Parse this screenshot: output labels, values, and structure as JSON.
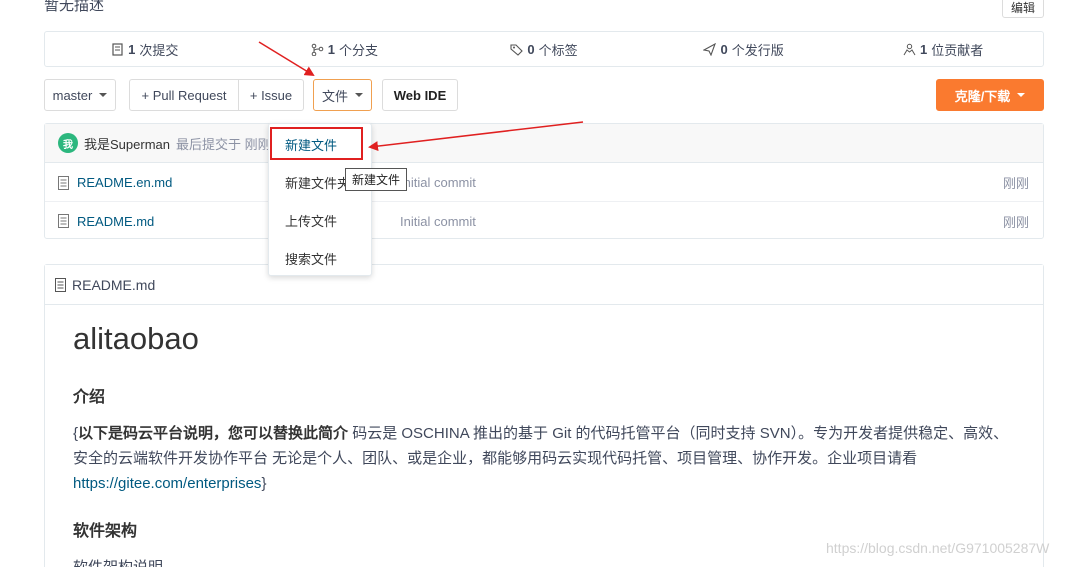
{
  "repo": {
    "description": "暂无描述",
    "edit_label": "编辑"
  },
  "stats": {
    "commits_count": "1",
    "commits_label": "次提交",
    "branches_count": "1",
    "branches_label": "个分支",
    "tags_count": "0",
    "tags_label": "个标签",
    "releases_count": "0",
    "releases_label": "个发行版",
    "contributors_count": "1",
    "contributors_label": "位贡献者"
  },
  "toolbar": {
    "branch": "master",
    "pull_request": "+ Pull Request",
    "issue": "+ Issue",
    "file_menu": "文件",
    "web_ide": "Web IDE",
    "clone": "克隆/下载"
  },
  "file_menu_items": [
    {
      "label": "新建文件"
    },
    {
      "label": "新建文件夹"
    },
    {
      "label": "上传文件"
    },
    {
      "label": "搜索文件"
    }
  ],
  "tooltip": "新建文件",
  "last_commit": {
    "avatar_text": "我",
    "author": "我是Superman",
    "meta": "最后提交于 刚刚"
  },
  "files": [
    {
      "name": "README.en.md",
      "message": "Initial commit",
      "time": "刚刚"
    },
    {
      "name": "README.md",
      "message": "Initial commit",
      "time": "刚刚"
    }
  ],
  "readme": {
    "file_name": "README.md",
    "title": "alitaobao",
    "section1": "介绍",
    "intro_open": "{",
    "intro_bold": "以下是码云平台说明，您可以替换此简介",
    "intro_text": " 码云是 OSCHINA 推出的基于 Git 的代码托管平台（同时支持 SVN）。专为开发者提供稳定、高效、安全的云端软件开发协作平台 无论是个人、团队、或是企业，都能够用码云实现代码托管、项目管理、协作开发。企业项目请看 ",
    "intro_link": "https://gitee.com/enterprises",
    "intro_close": "}",
    "section2": "软件架构",
    "section2_text": "软件架构说明"
  },
  "watermark": "https://blog.csdn.net/G971005287W",
  "colors": {
    "accent_orange": "#fa7a2f",
    "link_blue": "#005980",
    "annotation_red": "#e02020",
    "avatar_green": "#2cb77e"
  }
}
